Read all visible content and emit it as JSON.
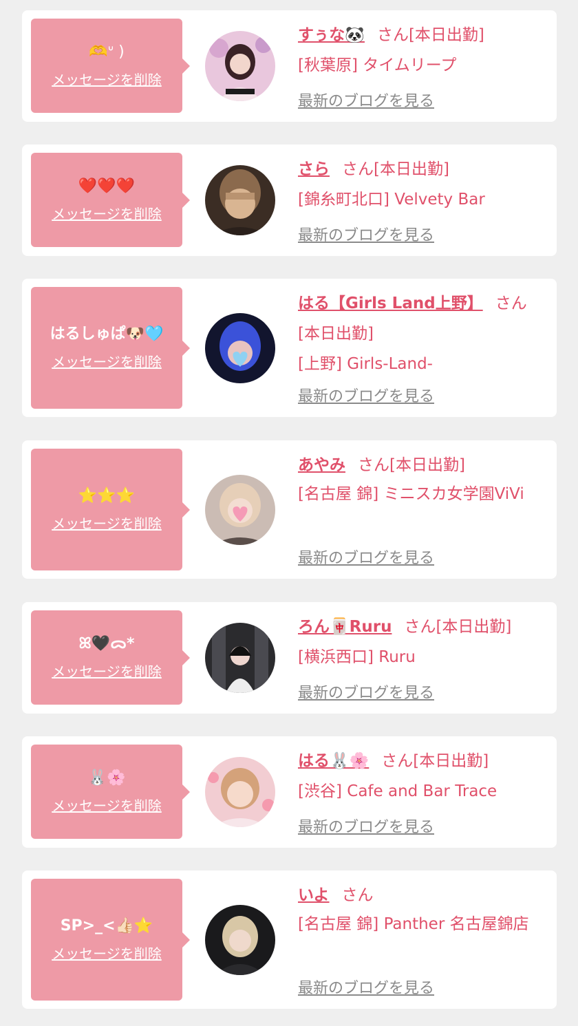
{
  "messages": [
    {
      "message": "🫶ᐡ )",
      "name": "すぅな🐼",
      "suffix": "さん[本日出勤]",
      "line2": "",
      "shop": "[秋葉原] タイムリープ",
      "delete_label": "メッセージを削除",
      "blog_label": "最新のブログを見る"
    },
    {
      "message": "❤️❤️❤️",
      "name": "さら",
      "suffix": "さん[本日出勤]",
      "line2": "",
      "shop": "[錦糸町北口] Velvety Bar",
      "delete_label": "メッセージを削除",
      "blog_label": "最新のブログを見る"
    },
    {
      "message": "はるしゅぱ🐶🩵",
      "name": "はる【Girls Land上野】",
      "suffix": "さん",
      "line2": "[本日出勤]",
      "shop": "[上野] Girls-Land-",
      "delete_label": "メッセージを削除",
      "blog_label": "最新のブログを見る"
    },
    {
      "message": "⭐️⭐️⭐️",
      "name": "あやみ",
      "suffix": "さん[本日出勤]",
      "line2": "",
      "shop": "[名古屋 錦] ミニスカ女学園ViVi",
      "delete_label": "メッセージを削除",
      "blog_label": "最新のブログを見る"
    },
    {
      "message": "ꕤ🖤ᯅ*",
      "name": "ろん🀄Ruru",
      "suffix": "さん[本日出勤]",
      "line2": "",
      "shop": "[横浜西口] Ruru",
      "delete_label": "メッセージを削除",
      "blog_label": "最新のブログを見る"
    },
    {
      "message": "🐰🌸",
      "name": "はる🐰🌸",
      "suffix": "さん[本日出勤]",
      "line2": "",
      "shop": "[渋谷] Cafe and Bar Trace",
      "delete_label": "メッセージを削除",
      "blog_label": "最新のブログを見る"
    },
    {
      "message": "SP>_<👍🏻⭐️",
      "name": "いよ",
      "suffix": "さん",
      "line2": "",
      "shop": "[名古屋 錦] Panther 名古屋錦店",
      "delete_label": "メッセージを削除",
      "blog_label": "最新のブログを見る"
    }
  ],
  "colors": {
    "accent": "#e0506a",
    "bubble": "#ee9aa6",
    "background": "#efefef",
    "link_gray": "#8a8a8a"
  }
}
